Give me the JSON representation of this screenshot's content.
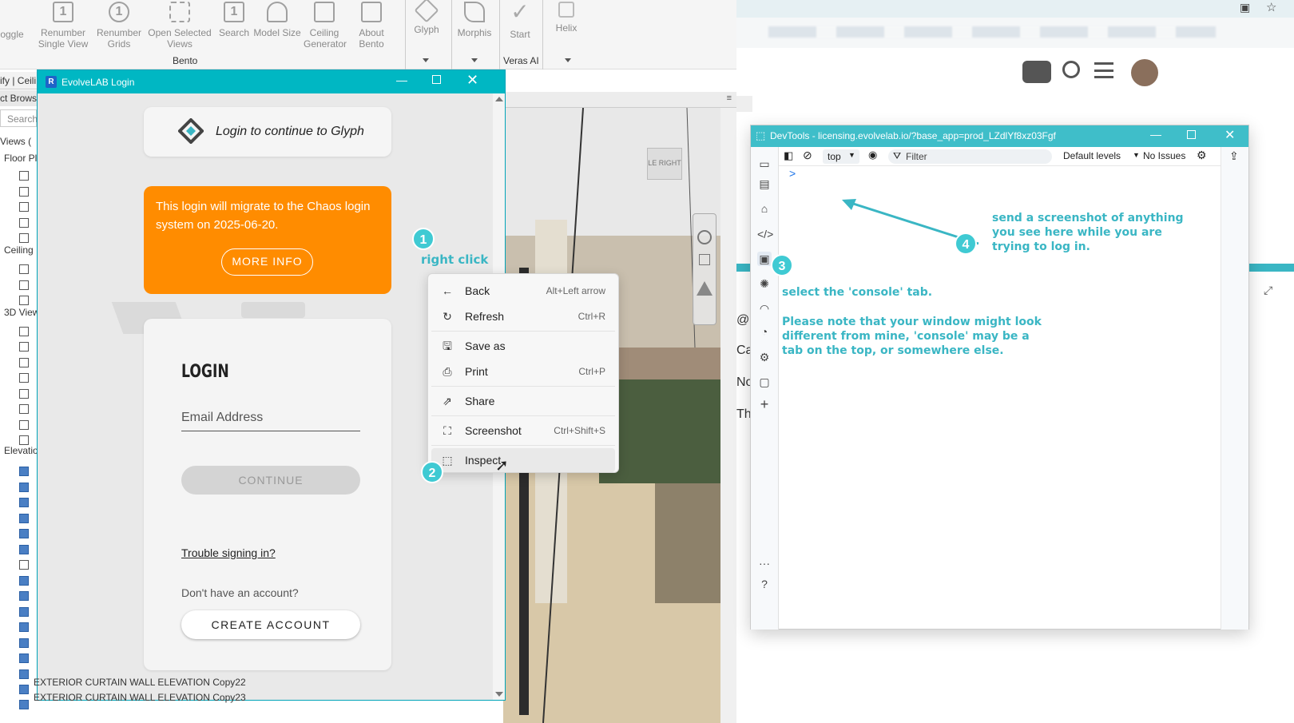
{
  "ribbon": {
    "items": [
      {
        "label": "oggle"
      },
      {
        "label": "Renumber\nSingle View"
      },
      {
        "label": "Renumber\nGrids"
      },
      {
        "label": "Open Selected\nViews"
      },
      {
        "label": "Search"
      },
      {
        "label": "Model Size"
      },
      {
        "label": "Ceiling\nGenerator"
      },
      {
        "label": "About\nBento"
      },
      {
        "label": "Glyph"
      },
      {
        "label": "Morphis"
      },
      {
        "label": "Start"
      },
      {
        "label": "Helix"
      }
    ],
    "panel_bento": "Bento",
    "panel_veras": "Veras AI"
  },
  "revit": {
    "tab_left": "ify | Ceili",
    "project_browser": "ct Browse",
    "search": "Search",
    "views": "Views (",
    "floor_plans": "Floor Pl",
    "ceiling": "Ceiling",
    "views_3d": "3D View",
    "elevations": "Elevatio",
    "row_1": "EXTERIOR CURTAIN WALL ELEVATION Copy22",
    "row_2": "EXTERIOR CURTAIN WALL ELEVATION Copy23"
  },
  "viewcube": {
    "face": "RIGHT",
    "side": "LE"
  },
  "login_window": {
    "title": "EvolveLAB Login",
    "header": "Login to continue to Glyph",
    "notice": "This login will migrate to the Chaos login system on 2025-06-20.",
    "more_info": "MORE INFO",
    "login_heading": "LOGIN",
    "email_placeholder": "Email Address",
    "continue": "CONTINUE",
    "trouble": "Trouble signing in?",
    "no_account": "Don't have an account?",
    "create_account": "CREATE ACCOUNT"
  },
  "context_menu": {
    "items": [
      {
        "label": "Back",
        "shortcut": "Alt+Left arrow",
        "icon": "arrow-left-icon"
      },
      {
        "label": "Refresh",
        "shortcut": "Ctrl+R",
        "icon": "refresh-icon"
      },
      {
        "label": "Save as",
        "shortcut": "",
        "icon": "save-icon"
      },
      {
        "label": "Print",
        "shortcut": "Ctrl+P",
        "icon": "print-icon"
      },
      {
        "label": "Share",
        "shortcut": "",
        "icon": "share-icon"
      },
      {
        "label": "Screenshot",
        "shortcut": "Ctrl+Shift+S",
        "icon": "screenshot-icon"
      },
      {
        "label": "Inspect",
        "shortcut": "",
        "icon": "inspect-icon"
      }
    ]
  },
  "annotations": {
    "step1": "1",
    "step1_text": "right click",
    "step2": "2",
    "step3": "3",
    "step3_text": "select the 'console' tab.",
    "step3_note": "Please note that your window might look different from mine, 'console' may be a tab on the top, or somewhere else.",
    "step4": "4",
    "step4_text": "send a screenshot of anything you see here while you are trying to log in."
  },
  "devtools": {
    "title": "DevTools - licensing.evolvelab.io/?base_app=prod_LZdlYf8xz03Fgf",
    "context": "top",
    "filter_placeholder": "Filter",
    "levels": "Default levels",
    "issues": "No Issues",
    "prompt": ">"
  },
  "browser": {
    "side_text_1": "@",
    "side_text_2": "Ca",
    "side_text_3": "No",
    "side_text_4": "Th"
  },
  "colors": {
    "teal": "#00b7c3",
    "orange": "#ff8c00",
    "annotation": "#3ab6c4"
  }
}
